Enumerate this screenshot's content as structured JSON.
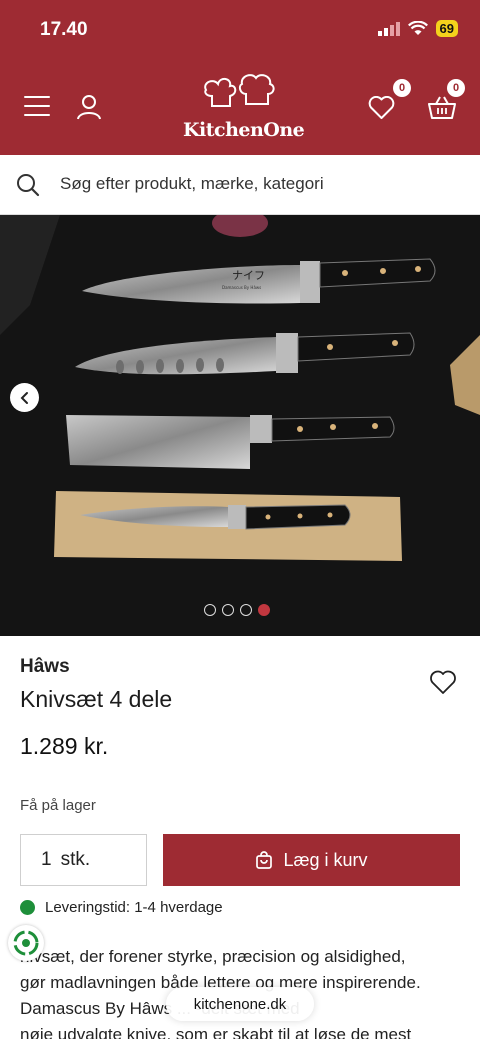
{
  "status_bar": {
    "time": "17.40",
    "battery": "69"
  },
  "header": {
    "logo_text": "KitchenOne",
    "wishlist_count": "0",
    "cart_count": "0",
    "brand_color": "#9e2b33"
  },
  "search": {
    "placeholder": "Søg efter produkt, mærke, kategori"
  },
  "gallery": {
    "image_labels": [
      "ナイフ",
      "Damascus By Hâws"
    ],
    "slides": 4,
    "active_slide": 4
  },
  "product": {
    "brand": "Hâws",
    "title": "Knivsæt 4 dele",
    "price": "1.289 kr.",
    "stock": "Få på lager",
    "quantity": "1",
    "quantity_unit": "stk.",
    "add_to_cart": "Læg i kurv",
    "delivery": "Leveringstid: 1-4 hverdage",
    "description_lines": [
      "nivsæt, der forener styrke, præcision og alsidighed,",
      "gør madlavningen både lettere og mere inspirerende.",
      "Damascus By Hâws ... -delt sæt med",
      "nøje udvalgte knive, som er skabt til at løse de mest"
    ]
  },
  "browser": {
    "url": "kitchenone.dk"
  }
}
